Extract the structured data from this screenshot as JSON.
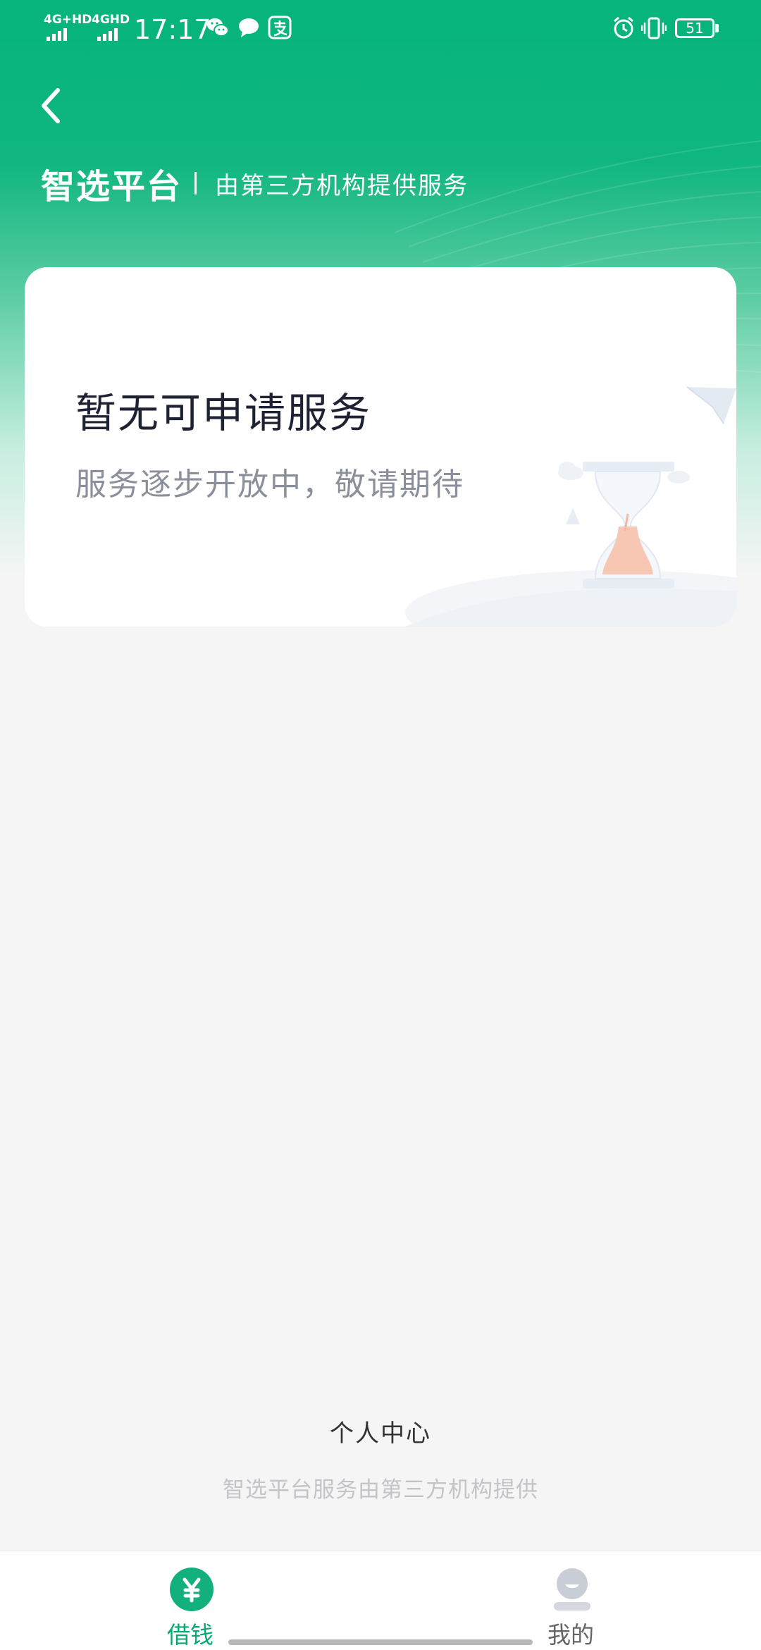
{
  "status_bar": {
    "network_1": "4G+HD",
    "network_2": "4GHD",
    "time": "17:17",
    "battery": "51"
  },
  "header": {
    "title": "智选平台",
    "subtitle": "由第三方机构提供服务"
  },
  "empty_state": {
    "title": "暂无可申请服务",
    "description": "服务逐步开放中，敬请期待"
  },
  "footer": {
    "personal_center": "个人中心",
    "note": "智选平台服务由第三方机构提供"
  },
  "bottom_nav": {
    "items": [
      {
        "label": "借钱",
        "icon": "yuan-icon",
        "active": true
      },
      {
        "label": "我的",
        "icon": "user-icon",
        "active": false
      }
    ]
  },
  "colors": {
    "brand_green": "#06b47c",
    "active_tab": "#0aa873",
    "inactive_tab": "#666666"
  }
}
